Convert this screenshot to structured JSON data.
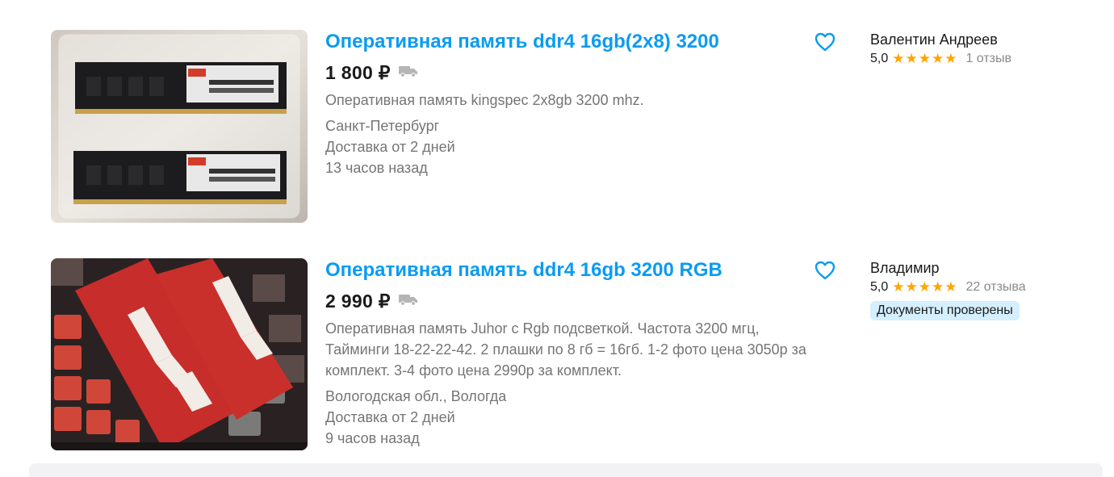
{
  "listings": [
    {
      "title": "Оперативная память ddr4 16gb(2x8) 3200",
      "price": "1 800 ₽",
      "description": "Оперативная память kingspec 2x8gb 3200 mhz.",
      "location": "Санкт-Петербург",
      "delivery": "Доставка от 2 дней",
      "posted": "13 часов назад",
      "seller_name": "Валентин Андреев",
      "rating": "5,0",
      "stars": "★★★★★",
      "reviews": "1 отзыв",
      "icons": {
        "favorite": "heart-outline-icon",
        "delivery": "truck-icon"
      }
    },
    {
      "title": "Оперативная память ddr4 16gb 3200 RGB",
      "price": "2 990 ₽",
      "description": "Оперативная память Juhor с Rgb подсветкой. Частота 3200 мгц, Тайминги 18-22-22-42. 2 плашки по 8 гб = 16гб. 1-2 фото цена 3050р за комплект. 3-4 фото цена 2990р за комплект.",
      "location": "Вологодская обл., Вологда",
      "delivery": "Доставка от 2 дней",
      "posted": "9 часов назад",
      "seller_name": "Владимир",
      "rating": "5,0",
      "stars": "★★★★★",
      "reviews": "22 отзыва",
      "badge": "Документы проверены",
      "icons": {
        "favorite": "heart-outline-icon",
        "delivery": "truck-icon"
      }
    }
  ],
  "colors": {
    "link": "#0a9bf2",
    "star": "#ffa500",
    "badge_bg": "#d4efff",
    "secondary_text": "#757575"
  }
}
